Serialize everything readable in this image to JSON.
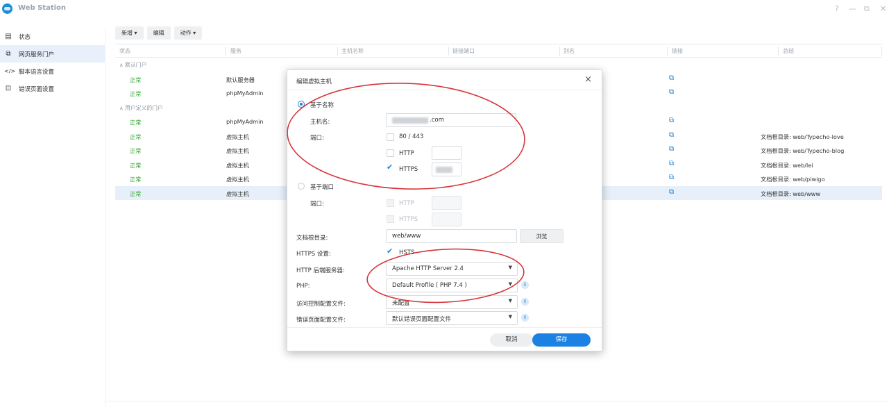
{
  "app": {
    "title": "Web Station",
    "controls": [
      "?",
      "—",
      "⧉",
      "✕"
    ]
  },
  "sidebar": {
    "items": [
      {
        "label": "状态",
        "icon": "status-icon",
        "active": false
      },
      {
        "label": "网页服务门户",
        "icon": "portal-icon",
        "active": true
      },
      {
        "label": "脚本语言设置",
        "icon": "code-icon",
        "active": false
      },
      {
        "label": "错误页面设置",
        "icon": "error-page-icon",
        "active": false
      }
    ]
  },
  "toolbar": {
    "new_label": "新增 ▾",
    "edit_label": "编辑",
    "action_label": "动作 ▾"
  },
  "table": {
    "columns": [
      "状态",
      "服务",
      "主机名称",
      "链接端口",
      "别名",
      "链接",
      "总结"
    ],
    "groups": [
      {
        "title": "∧  默认门户",
        "rows": [
          {
            "status": "正常",
            "service": "默认服务器",
            "summary": ""
          },
          {
            "status": "正常",
            "service": "phpMyAdmin",
            "summary": ""
          }
        ]
      },
      {
        "title": "∧  用户定义的门户",
        "rows": [
          {
            "status": "正常",
            "service": "phpMyAdmin",
            "summary": ""
          },
          {
            "status": "正常",
            "service": "虚拟主机",
            "summary": "文档根目录: web/Typecho-love"
          },
          {
            "status": "正常",
            "service": "虚拟主机",
            "summary": "文档根目录: web/Typecho-blog"
          },
          {
            "status": "正常",
            "service": "虚拟主机",
            "summary": "文档根目录: web/lei"
          },
          {
            "status": "正常",
            "service": "虚拟主机",
            "summary": "文档根目录: web/piwigo"
          },
          {
            "status": "正常",
            "service": "虚拟主机",
            "summary": "文档根目录: web/www"
          }
        ]
      }
    ]
  },
  "dialog": {
    "title": "编辑虚拟主机",
    "name_based": {
      "label": "基于名称",
      "hostname_label": "主机名:",
      "hostname_value": ".com",
      "port_label": "端口:",
      "port_80_443": "80 / 443",
      "http_label": "HTTP",
      "https_label": "HTTPS"
    },
    "port_based": {
      "label": "基于端口",
      "port_label": "端口:",
      "http_label": "HTTP",
      "https_label": "HTTPS"
    },
    "docroot_label": "文档根目录:",
    "docroot_value": "web/www",
    "browse_label": "浏览",
    "https_settings_label": "HTTPS 设置:",
    "hsts_label": "HSTS",
    "backend_label": "HTTP 后端服务器:",
    "backend_value": "Apache HTTP Server 2.4",
    "php_label": "PHP:",
    "php_value": "Default Profile ( PHP 7.4 )",
    "access_label": "访问控制配置文件:",
    "access_value": "未配置",
    "error_label": "错误页面配置文件:",
    "error_value": "默认错误页面配置文件",
    "cancel_label": "取消",
    "save_label": "保存"
  },
  "colors": {
    "accent": "#1b82e3",
    "status_ok": "#33a533",
    "annotation": "#d6353a"
  }
}
